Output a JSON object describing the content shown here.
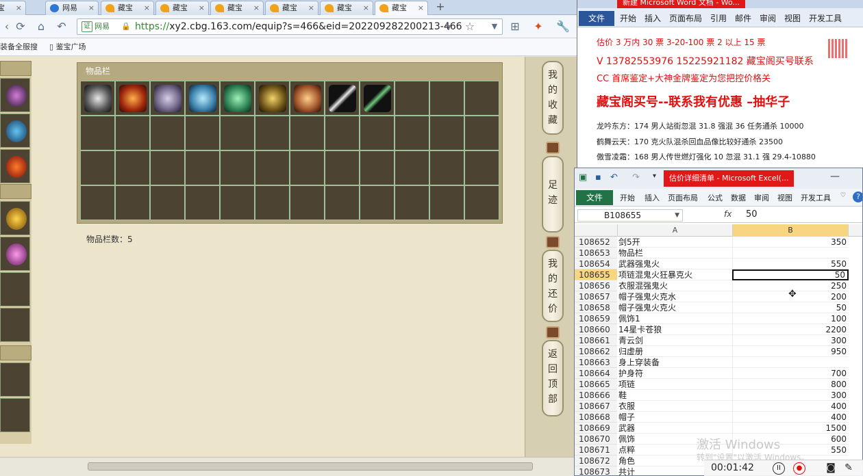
{
  "browser": {
    "tabs": [
      {
        "label": "鉴宝"
      },
      {
        "label": "网易"
      },
      {
        "label": "藏宝"
      },
      {
        "label": "藏宝"
      },
      {
        "label": "藏宝"
      },
      {
        "label": "藏宝"
      },
      {
        "label": "藏宝"
      },
      {
        "label": "藏宝"
      }
    ],
    "new_tab": "+",
    "url_cert": "证",
    "url_cert_name": "网易",
    "url_scheme": "https://",
    "url_rest": "xy2.cbg.163.com/equip?s=466&eid=202209282200213-466",
    "bookmarks": [
      "装备全服搜",
      "鉴宝广场"
    ]
  },
  "page": {
    "item_panel_title": "物品栏",
    "item_count_label": "物品栏数：5",
    "sidebar_buttons": [
      {
        "chars": [
          "我",
          "的",
          "收",
          "藏"
        ]
      },
      {
        "chars": [
          "足",
          "迹"
        ]
      },
      {
        "chars": [
          "我",
          "的",
          "还",
          "价"
        ]
      },
      {
        "chars": [
          "返",
          "回",
          "顶",
          "部"
        ]
      }
    ]
  },
  "word": {
    "title": "新建 Microsoft Word 文档 - Wo...",
    "file_tab": "文件",
    "tabs": [
      "开始",
      "插入",
      "页面布局",
      "引用",
      "邮件",
      "审阅",
      "视图",
      "开发工具"
    ],
    "lines": [
      "估价 3 万内 30 票    3-20-100 票    2   以上 15 票",
      "V 13782553976    15225921182    藏宝阁买号联系",
      "CC 首席鉴定+大神金牌鉴定为您把控价格关",
      "藏宝阁买号--联系我有优惠 –抽华子",
      "龙吟东方：174 男人站街忽混 31.8 强混 36 任务通杀 10000",
      "鹤舞云天：170 克火队混杀回血品像比较好通杀 23500",
      "傲雪凌霜：168 男人传世燃灯强化 10 忽混 31.1 强 29.4-10880"
    ]
  },
  "excel": {
    "title": "估价详细清单 - Microsoft Excel(...",
    "file_tab": "文件",
    "tabs": [
      "开始",
      "插入",
      "页面布局",
      "公式",
      "数据",
      "审阅",
      "视图",
      "开发工具"
    ],
    "help": "?",
    "name_box": "B108655",
    "fx": "fx",
    "formula_value": "50",
    "col_a": "A",
    "col_b": "B",
    "rows": [
      {
        "n": "108652",
        "a": "剑5开",
        "b": "350"
      },
      {
        "n": "108653",
        "a": "物品栏",
        "b": ""
      },
      {
        "n": "108654",
        "a": "武器强鬼火",
        "b": "550"
      },
      {
        "n": "108655",
        "a": "项链混鬼火狂暴克火",
        "b": "50"
      },
      {
        "n": "108656",
        "a": "衣服混强鬼火",
        "b": "250"
      },
      {
        "n": "108657",
        "a": "帽子强鬼火克水",
        "b": "200"
      },
      {
        "n": "108658",
        "a": "帽子强鬼火克火",
        "b": "50"
      },
      {
        "n": "108659",
        "a": "佩饰1",
        "b": "100"
      },
      {
        "n": "108660",
        "a": "14星卡苍狼",
        "b": "2200"
      },
      {
        "n": "108661",
        "a": "青云剑",
        "b": "300"
      },
      {
        "n": "108662",
        "a": "归虚册",
        "b": "950"
      },
      {
        "n": "108663",
        "a": "身上穿装备",
        "b": ""
      },
      {
        "n": "108664",
        "a": "护身符",
        "b": "700"
      },
      {
        "n": "108665",
        "a": "项链",
        "b": "800"
      },
      {
        "n": "108666",
        "a": "鞋",
        "b": "300"
      },
      {
        "n": "108667",
        "a": "衣服",
        "b": "400"
      },
      {
        "n": "108668",
        "a": "帽子",
        "b": "400"
      },
      {
        "n": "108669",
        "a": "武器",
        "b": "1500"
      },
      {
        "n": "108670",
        "a": "佩饰",
        "b": "600"
      },
      {
        "n": "108671",
        "a": "点粹",
        "b": "550"
      },
      {
        "n": "108672",
        "a": "角色",
        "b": ""
      },
      {
        "n": "108673",
        "a": "共计",
        "b": ""
      }
    ],
    "selected_row": "108655",
    "watermark": "激活 Windows",
    "watermark_sub": "转到\"设置\"以激活 Windows。"
  },
  "recorder": {
    "time": "00:01:42",
    "pause": "II",
    "stop": "●"
  },
  "colors": {
    "accent_red": "#e01010",
    "excel_green": "#217346",
    "word_blue": "#2b579a"
  }
}
